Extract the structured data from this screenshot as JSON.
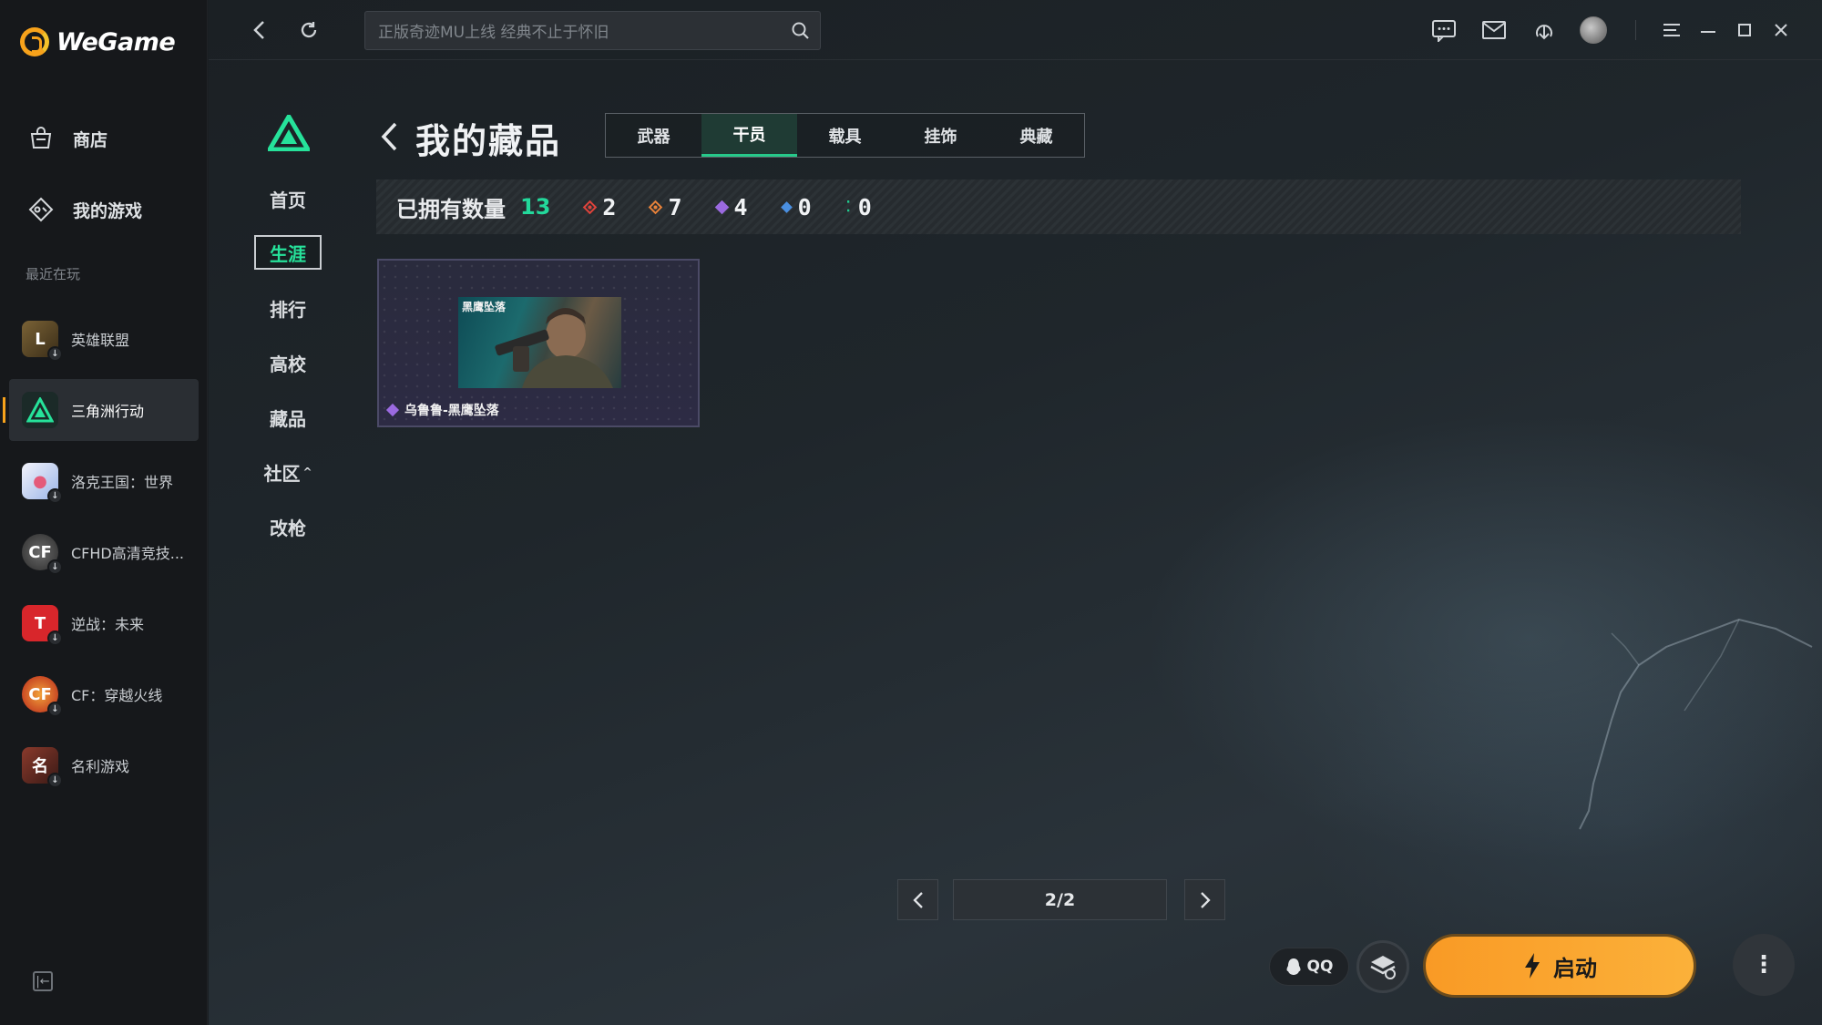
{
  "app": {
    "brand": "WeGame"
  },
  "sidebar": {
    "nav": [
      {
        "label": "商店",
        "icon": "store-bag-icon"
      },
      {
        "label": "我的游戏",
        "icon": "gamepad-icon"
      }
    ],
    "recent_title": "最近在玩",
    "games": [
      {
        "label": "英雄联盟",
        "icon_color": "#5b4a2b",
        "active": false
      },
      {
        "label": "三角洲行动",
        "icon_color": "#1a2c2a",
        "active": true
      },
      {
        "label": "洛克王国：世界",
        "icon_color": "#e8e8f0",
        "active": false
      },
      {
        "label": "CFHD高清竞技...",
        "icon_color": "#4a4a4a",
        "active": false
      },
      {
        "label": "逆战：未来",
        "icon_color": "#d8262b",
        "active": false
      },
      {
        "label": "CF：穿越火线",
        "icon_color": "#c93a1e",
        "active": false
      },
      {
        "label": "名利游戏",
        "icon_color": "#7a2a22",
        "active": false
      }
    ]
  },
  "topbar": {
    "search_placeholder": "正版奇迹MU上线 经典不止于怀旧"
  },
  "game_nav": {
    "items": [
      "首页",
      "生涯",
      "排行",
      "高校",
      "藏品",
      "社区",
      "改枪"
    ],
    "active": "生涯"
  },
  "page": {
    "title": "我的藏品",
    "tabs": [
      "武器",
      "干员",
      "载具",
      "挂饰",
      "典藏"
    ],
    "active_tab": "干员"
  },
  "stats": {
    "label": "已拥有数量",
    "total": "13",
    "counts": [
      {
        "value": "2",
        "color": "#e0433b"
      },
      {
        "value": "7",
        "color": "#e8823a"
      },
      {
        "value": "4",
        "color": "#9b6ae0"
      },
      {
        "value": "0",
        "color": "#4a8fe0"
      },
      {
        "value": "0",
        "color": "#22c98e"
      }
    ]
  },
  "items": [
    {
      "name": "乌鲁鲁-黑鹰坠落",
      "image_tag": "黑鹰坠落",
      "rarity_color": "#9b6ae0"
    }
  ],
  "pager": {
    "text": "2/2"
  },
  "footer": {
    "qq_label": "QQ",
    "launch_label": "启动",
    "more_label": "⋮"
  }
}
